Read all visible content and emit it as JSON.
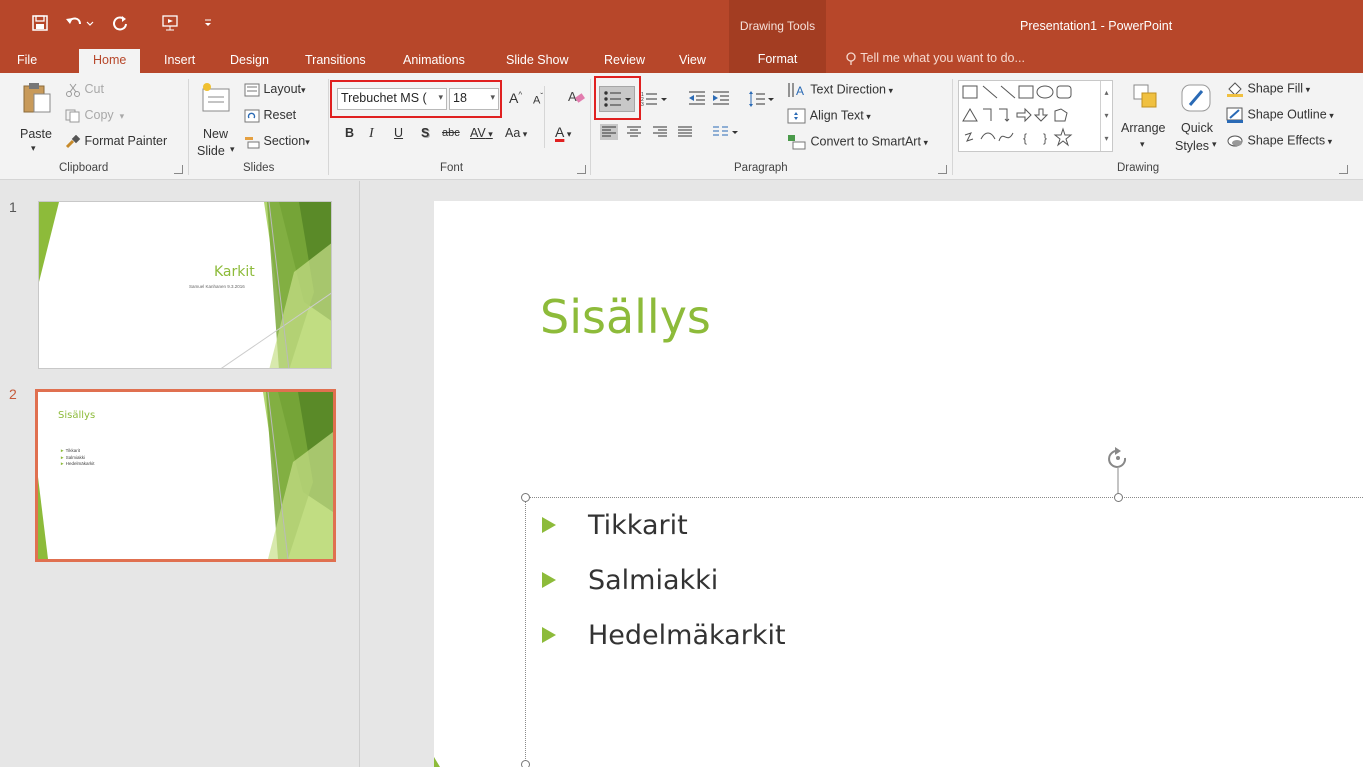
{
  "title_bar": {
    "contextual_group": "Drawing Tools",
    "app_title": "Presentation1 - PowerPoint"
  },
  "tabs": [
    "File",
    "Home",
    "Insert",
    "Design",
    "Transitions",
    "Animations",
    "Slide Show",
    "Review",
    "View",
    "Format"
  ],
  "active_tab": "Home",
  "tell_me": "Tell me what you want to do...",
  "clipboard": {
    "paste": "Paste",
    "cut": "Cut",
    "copy": "Copy",
    "format_painter": "Format Painter",
    "label": "Clipboard"
  },
  "slides_group": {
    "new_slide_1": "New",
    "new_slide_2": "Slide",
    "layout": "Layout",
    "reset": "Reset",
    "section": "Section",
    "label": "Slides"
  },
  "font": {
    "name": "Trebuchet MS (",
    "size": "18",
    "grow": "A",
    "shrink": "A",
    "bold": "B",
    "italic": "I",
    "underline": "U",
    "shadow": "S",
    "strike": "abc",
    "spacing": "AV",
    "case": "Aa",
    "color": "A",
    "label": "Font"
  },
  "paragraph": {
    "text_direction": "Text Direction",
    "align_text": "Align Text",
    "convert_smartart": "Convert to SmartArt",
    "label": "Paragraph"
  },
  "drawing": {
    "arrange": "Arrange",
    "quick_styles_1": "Quick",
    "quick_styles_2": "Styles",
    "shape_fill": "Shape Fill",
    "shape_outline": "Shape Outline",
    "shape_effects": "Shape Effects",
    "label": "Drawing"
  },
  "thumbnails": [
    {
      "number": "1",
      "title": "Karkit",
      "subtitle": "Samuel Kanhanen 9.3.2016"
    },
    {
      "number": "2",
      "title": "Sisällys",
      "bullets": [
        "Tikkarit",
        "Salmiakki",
        "Hedelmäkarkit"
      ]
    }
  ],
  "slide": {
    "title": "Sisällys",
    "bullets": [
      "Tikkarit",
      "Salmiakki",
      "Hedelmäkarkit"
    ]
  },
  "colors": {
    "accent": "#b7472a",
    "slide_green": "#8dbb3a",
    "highlight_red": "#e02020"
  }
}
